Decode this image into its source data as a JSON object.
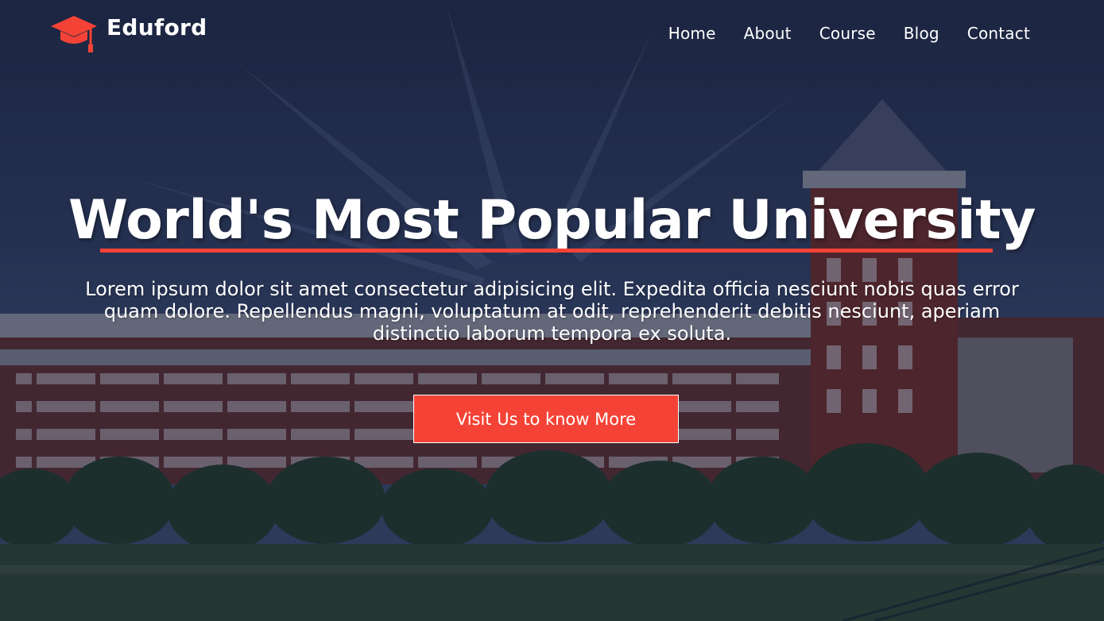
{
  "brand": {
    "name": "Eduford",
    "accent_color": "#f44336",
    "icon": "graduation-cap-icon"
  },
  "nav": {
    "items": [
      {
        "label": "Home"
      },
      {
        "label": "About"
      },
      {
        "label": "Course"
      },
      {
        "label": "Blog"
      },
      {
        "label": "Contact"
      }
    ]
  },
  "hero": {
    "title": "World's Most Popular University",
    "text": "Lorem ipsum dolor sit amet consectetur adipisicing elit. Expedita officia nesciunt nobis quas error quam dolore. Repellendus magni, voluptatum at odit, reprehenderit debitis nesciunt, aperiam distinctio laborum tempora ex soluta.",
    "button_label": "Visit Us to know More",
    "background": "university-campus-photo"
  }
}
